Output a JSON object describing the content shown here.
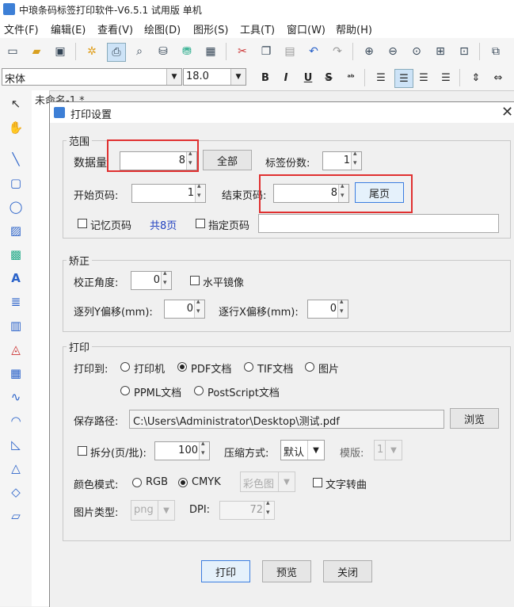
{
  "app": {
    "title": "中琅条码标签打印软件-V6.5.1 试用版 单机",
    "menu": [
      "文件(F)",
      "编辑(E)",
      "查看(V)",
      "绘图(D)",
      "图形(S)",
      "工具(T)",
      "窗口(W)",
      "帮助(H)"
    ],
    "font_name": "宋体",
    "font_size": "18.0",
    "format_buttons": [
      "B",
      "I",
      "U",
      "S"
    ],
    "doc_tab": "未命名-1 *"
  },
  "dialog": {
    "title": "打印设置",
    "range": {
      "title": "范围",
      "data_count_label": "数据量",
      "data_count_value": "8",
      "all_button": "全部",
      "copies_label": "标签份数:",
      "copies_value": "1",
      "start_page_label": "开始页码:",
      "start_page_value": "1",
      "end_page_label": "结束页码:",
      "end_page_value": "8",
      "last_page_button": "尾页",
      "remember_page_label": "记忆页码",
      "total_pages": "共8页",
      "specify_page_label": "指定页码",
      "specify_page_value": ""
    },
    "correction": {
      "title": "矫正",
      "angle_label": "校正角度:",
      "angle_value": "0",
      "mirror_label": "水平镜像",
      "col_y_offset_label": "逐列Y偏移(mm):",
      "col_y_offset_value": "0",
      "row_x_offset_label": "逐行X偏移(mm):",
      "row_x_offset_value": "0"
    },
    "print": {
      "title": "打印",
      "print_to_label": "打印到:",
      "targets": [
        "打印机",
        "PDF文档",
        "TIF文档",
        "图片",
        "PPML文档",
        "PostScript文档"
      ],
      "selected_target": "PDF文档",
      "save_path_label": "保存路径:",
      "save_path_value": "C:\\Users\\Administrator\\Desktop\\测试.pdf",
      "browse_button": "浏览",
      "split_label": "拆分(页/批):",
      "split_value": "100",
      "compress_label": "压缩方式:",
      "compress_value": "默认",
      "template_label": "模版:",
      "template_value": "1",
      "color_mode_label": "颜色模式:",
      "color_rgb": "RGB",
      "color_cmyk": "CMYK",
      "color_mode_selected": "CMYK",
      "color_image_value": "彩色图",
      "text_to_curve_label": "文字转曲",
      "image_type_label": "图片类型:",
      "image_type_value": "png",
      "dpi_label": "DPI:",
      "dpi_value": "72"
    },
    "buttons": {
      "print": "打印",
      "preview": "预览",
      "close": "关闭"
    }
  },
  "colors": {
    "highlight_box": "#e03030",
    "accent_blue": "#3b7de0",
    "total_pages_text": "#2040c0"
  }
}
